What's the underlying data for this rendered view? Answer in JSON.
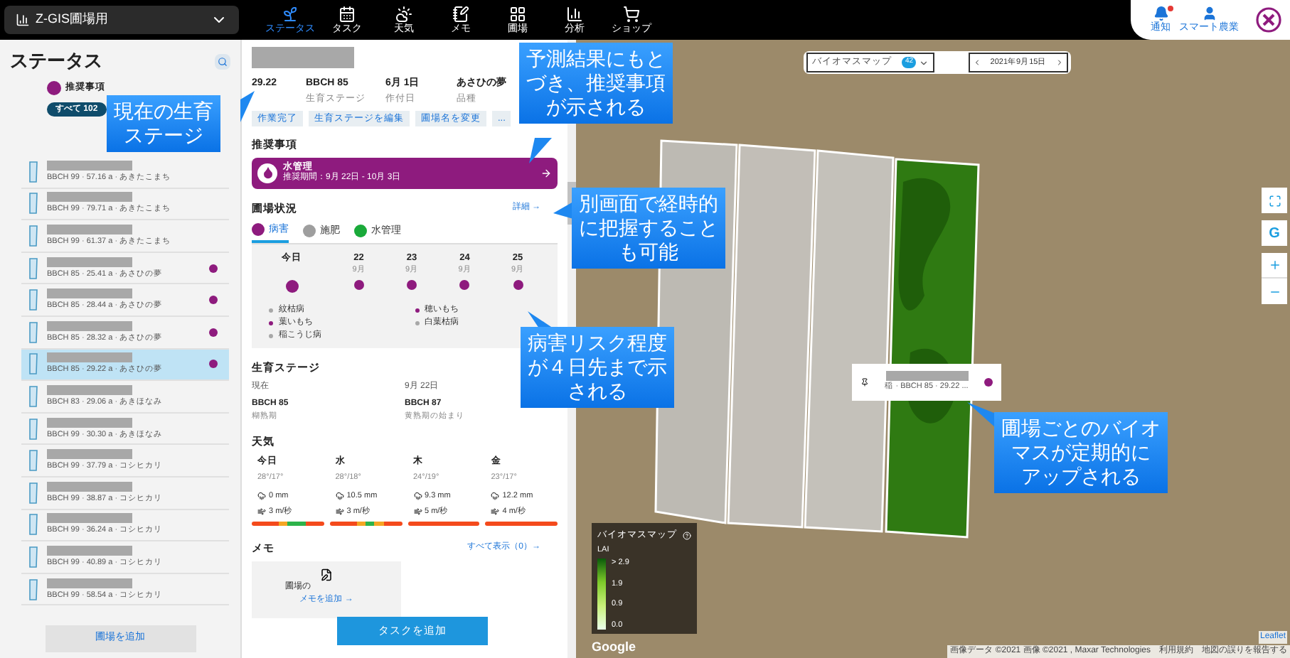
{
  "topbar": {
    "farm": "Z-GIS圃場用",
    "nav": [
      {
        "label": "ステータス",
        "selected": true
      },
      {
        "label": "タスク",
        "selected": false
      },
      {
        "label": "天気",
        "selected": false
      },
      {
        "label": "メモ",
        "selected": false
      },
      {
        "label": "圃場",
        "selected": false
      },
      {
        "label": "分析",
        "selected": false
      },
      {
        "label": "ショップ",
        "selected": false
      }
    ],
    "notifications": {
      "label": "通知",
      "unread": true
    },
    "account": "スマート農業"
  },
  "sidebar": {
    "title": "ステータス",
    "filter": "推奨事項",
    "chip": "すべて 102",
    "add_button": "圃場を追加",
    "fields": [
      {
        "subtitle": "BBCH 99 · 57.16 a · あきたこまち",
        "recommendation": false,
        "selected": false
      },
      {
        "subtitle": "BBCH 99 · 79.71 a · あきたこまち",
        "recommendation": false,
        "selected": false
      },
      {
        "subtitle": "BBCH 99 · 61.37 a · あきたこまち",
        "recommendation": false,
        "selected": false
      },
      {
        "subtitle": "BBCH 85 · 25.41 a · あさひの夢",
        "recommendation": true,
        "selected": false
      },
      {
        "subtitle": "BBCH 85 · 28.44 a · あさひの夢",
        "recommendation": true,
        "selected": false
      },
      {
        "subtitle": "BBCH 85 · 28.32 a · あさひの夢",
        "recommendation": true,
        "selected": false
      },
      {
        "subtitle": "BBCH 85 · 29.22 a · あさひの夢",
        "recommendation": true,
        "selected": true
      },
      {
        "subtitle": "BBCH 83 · 29.06 a · あきほなみ",
        "recommendation": false,
        "selected": false
      },
      {
        "subtitle": "BBCH 99 · 30.30 a · あきほなみ",
        "recommendation": false,
        "selected": false
      },
      {
        "subtitle": "BBCH 99 · 37.79 a · コシヒカリ",
        "recommendation": false,
        "selected": false
      },
      {
        "subtitle": "BBCH 99 · 38.87 a · コシヒカリ",
        "recommendation": false,
        "selected": false
      },
      {
        "subtitle": "BBCH 99 · 36.24 a · コシヒカリ",
        "recommendation": false,
        "selected": false
      },
      {
        "subtitle": "BBCH 99 · 40.89 a · コシヒカリ",
        "recommendation": false,
        "selected": false
      },
      {
        "subtitle": "BBCH 99 · 58.54 a · コシヒカリ",
        "recommendation": false,
        "selected": false
      }
    ]
  },
  "detail": {
    "stats": [
      {
        "value": "29.22"
      },
      {
        "value": "BBCH 85",
        "label": "生育ステージ"
      },
      {
        "value": "6月 1日",
        "label": "作付日"
      },
      {
        "value": "あさひの夢",
        "label": "品種"
      }
    ],
    "actions": [
      "作業完了",
      "生育ステージを編集",
      "圃場名を変更",
      "..."
    ],
    "recommendations": {
      "title": "推奨事項",
      "name": "水管理",
      "period": "推奨期間：9月 22日 - 10月 3日"
    },
    "status": {
      "title": "圃場状況",
      "link": "詳細 →",
      "tabs": [
        {
          "label": "病害",
          "color": "#8e1b7e",
          "selected": true
        },
        {
          "label": "施肥",
          "color": "#9e9e9e",
          "selected": false
        },
        {
          "label": "水管理",
          "color": "#1aaa3a",
          "selected": false
        }
      ],
      "days": [
        {
          "day": "今日",
          "color": "#8e1b7e"
        },
        {
          "day": "22",
          "month": "9月",
          "color": "#8e1b7e"
        },
        {
          "day": "23",
          "month": "9月",
          "color": "#8e1b7e"
        },
        {
          "day": "24",
          "month": "9月",
          "color": "#8e1b7e"
        },
        {
          "day": "25",
          "month": "9月",
          "color": "#8e1b7e"
        }
      ],
      "diseases": [
        {
          "name": "紋枯病",
          "color": "#a8a8a8"
        },
        {
          "name": "穂いもち",
          "color": "#8e1b7e"
        },
        {
          "name": "葉いもち",
          "color": "#8e1b7e"
        },
        {
          "name": "白葉枯病",
          "color": "#a8a8a8"
        },
        {
          "name": "稲こうじ病",
          "color": "#a8a8a8"
        }
      ]
    },
    "growth": {
      "title": "生育ステージ",
      "stages": [
        {
          "when": "現在",
          "stage": "BBCH 85",
          "desc": "糊熟期"
        },
        {
          "when": "9月 22日",
          "stage": "BBCH 87",
          "desc": "黄熟期の始まり"
        }
      ]
    },
    "weather": {
      "title": "天気",
      "days": [
        {
          "day": "今日",
          "temp": "28°/17°",
          "rain": "0 mm",
          "wind": "3 m/秒",
          "bar": [
            {
              "color": "#f44a1c"
            },
            {
              "color": "#f44a1c"
            },
            {
              "color": "#f44a1c"
            },
            {
              "color": "#f5a623"
            },
            {
              "color": "#2db34a"
            },
            {
              "color": "#2db34a"
            },
            {
              "color": "#f44a1c"
            },
            {
              "color": "#f44a1c"
            }
          ]
        },
        {
          "day": "水",
          "temp": "28°/18°",
          "rain": "10.5 mm",
          "wind": "3 m/秒",
          "bar": [
            {
              "color": "#f44a1c"
            },
            {
              "color": "#f44a1c"
            },
            {
              "color": "#f44a1c"
            },
            {
              "color": "#f5a623"
            },
            {
              "color": "#2db34a"
            },
            {
              "color": "#f5a623"
            },
            {
              "color": "#f44a1c"
            },
            {
              "color": "#f44a1c"
            }
          ]
        },
        {
          "day": "木",
          "temp": "24°/19°",
          "rain": "9.3 mm",
          "wind": "5 m/秒",
          "bar": [
            {
              "color": "#f44a1c"
            }
          ]
        },
        {
          "day": "金",
          "temp": "23°/17°",
          "rain": "12.2 mm",
          "wind": "4 m/秒",
          "bar": [
            {
              "color": "#f44a1c"
            }
          ]
        }
      ]
    },
    "memo": {
      "title": "メモ",
      "link": "すべて表示（0）→",
      "card_text": "圃場の",
      "card_link": "メモを追加 →"
    },
    "add_task": "タスクを追加"
  },
  "map": {
    "layer": "バイオマスマップ",
    "layer_badge": "42",
    "date": "2021年9月15日",
    "popup": {
      "text": "稲 · BBCH 85 · 29.22 ...",
      "color": "#8e1b7e"
    },
    "legend": {
      "title": "バイオマスマップ",
      "unit": "LAI",
      "ticks": [
        "> 2.9",
        "1.9",
        "0.9",
        "0.0"
      ]
    },
    "google_button": "G",
    "google": "Google",
    "attribution": "画像データ ©2021 画像 ©2021 , Maxar Technologies",
    "terms": "利用規約",
    "report": "地図の誤りを報告する",
    "leaflet": "Leaflet"
  },
  "callouts": [
    {
      "lines": [
        "現在の生育",
        "ステージ"
      ]
    },
    {
      "lines": [
        "予測結果にもと",
        "づき、推奨事項",
        "が示される"
      ]
    },
    {
      "lines": [
        "別画面で経時的",
        "に把握すること",
        "も可能"
      ]
    },
    {
      "lines": [
        "病害リスク程度",
        "が４日先まで示",
        "される"
      ]
    },
    {
      "lines": [
        "圃場ごとのバイオ",
        "マスが定期的に",
        "アップされる"
      ]
    }
  ]
}
